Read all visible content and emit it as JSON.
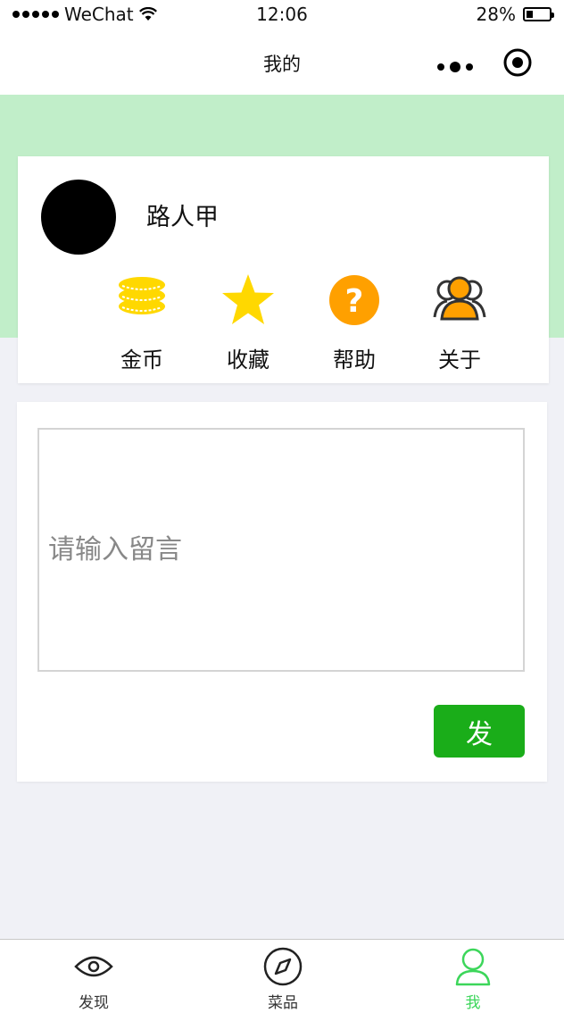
{
  "status_bar": {
    "carrier": "WeChat",
    "time": "12:06",
    "battery": "28%",
    "battery_level": 0.28
  },
  "nav": {
    "title": "我的",
    "more_icon": "more-dots-icon",
    "target_icon": "target-icon"
  },
  "profile": {
    "username": "路人甲"
  },
  "menu": [
    {
      "label": "金币",
      "icon": "coins-icon",
      "color": "#ffd800"
    },
    {
      "label": "收藏",
      "icon": "star-icon",
      "color": "#ffd800"
    },
    {
      "label": "帮助",
      "icon": "help-icon",
      "color": "#ffa000"
    },
    {
      "label": "关于",
      "icon": "users-icon",
      "color": "#ffa000"
    }
  ],
  "message": {
    "placeholder": "请输入留言",
    "send_label": "发"
  },
  "tabs": [
    {
      "label": "发现",
      "icon": "eye-icon",
      "active": false
    },
    {
      "label": "菜品",
      "icon": "compass-icon",
      "active": false
    },
    {
      "label": "我",
      "icon": "person-icon",
      "active": true
    }
  ],
  "colors": {
    "accent": "#1aad19",
    "header_band": "#c1eec9",
    "tab_active": "#3cd65a",
    "page_bg": "#f0f1f6"
  }
}
